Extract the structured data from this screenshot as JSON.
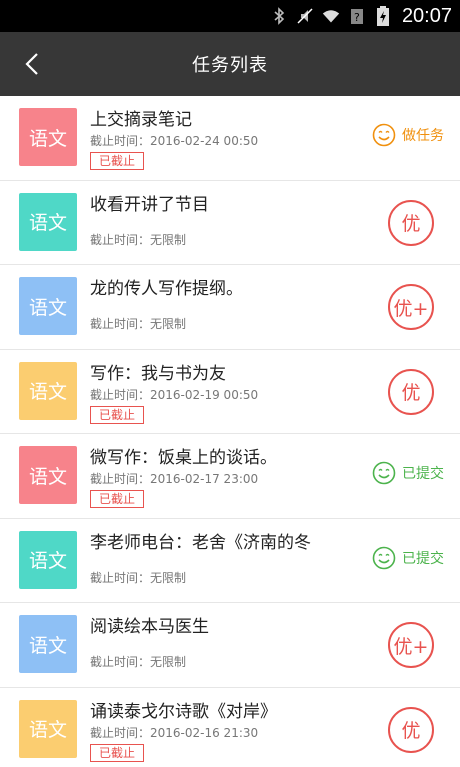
{
  "status_bar": {
    "time": "20:07"
  },
  "header": {
    "title": "任务列表"
  },
  "colors": {
    "pink": "#f7838b",
    "teal": "#4fd8c7",
    "blue": "#8ec0f5",
    "yellow": "#fbcd70",
    "orange": "#f0900e",
    "green": "#4cb34c",
    "red": "#e8534f"
  },
  "tasks": [
    {
      "subject": "语文",
      "color": "#f7838b",
      "title": "上交摘录笔记",
      "deadline": "截止时间：2016-02-24 00:50",
      "expired": "已截止",
      "status": "做任务",
      "status_color": "#f0900e"
    },
    {
      "subject": "语文",
      "color": "#4fd8c7",
      "title": "收看开讲了节目",
      "deadline": "截止时间：无限制",
      "grade": "优"
    },
    {
      "subject": "语文",
      "color": "#8ec0f5",
      "title": "龙的传人写作提纲。",
      "deadline": "截止时间：无限制",
      "grade": "优+"
    },
    {
      "subject": "语文",
      "color": "#fbcd70",
      "title": "写作：我与书为友",
      "deadline": "截止时间：2016-02-19 00:50",
      "expired": "已截止",
      "grade": "优"
    },
    {
      "subject": "语文",
      "color": "#f7838b",
      "title": "微写作：饭桌上的谈话。",
      "deadline": "截止时间：2016-02-17 23:00",
      "expired": "已截止",
      "status": "已提交",
      "status_color": "#4cb34c"
    },
    {
      "subject": "语文",
      "color": "#4fd8c7",
      "title": "李老师电台：老舍《济南的冬",
      "deadline": "截止时间：无限制",
      "status": "已提交",
      "status_color": "#4cb34c"
    },
    {
      "subject": "语文",
      "color": "#8ec0f5",
      "title": "阅读绘本马医生",
      "deadline": "截止时间：无限制",
      "grade": "优+"
    },
    {
      "subject": "语文",
      "color": "#fbcd70",
      "title": "诵读泰戈尔诗歌《对岸》",
      "deadline": "截止时间：2016-02-16 21:30",
      "expired": "已截止",
      "grade": "优"
    }
  ]
}
